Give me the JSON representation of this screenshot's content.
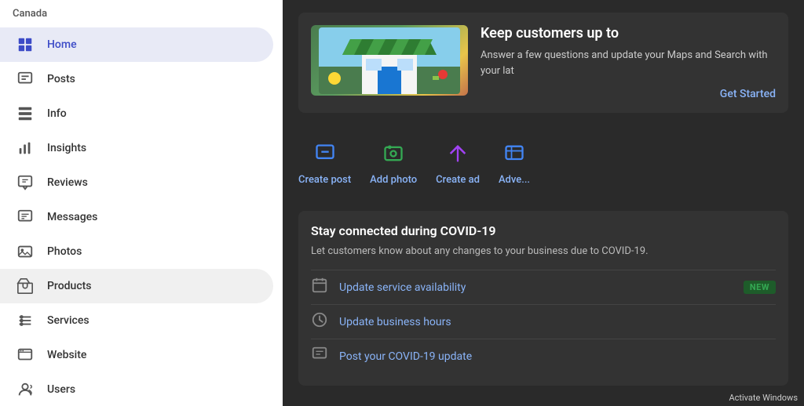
{
  "sidebar": {
    "header": "Canada",
    "items": [
      {
        "id": "home",
        "label": "Home",
        "icon": "home-icon",
        "active": true
      },
      {
        "id": "posts",
        "label": "Posts",
        "icon": "posts-icon",
        "active": false
      },
      {
        "id": "info",
        "label": "Info",
        "icon": "info-icon",
        "active": false
      },
      {
        "id": "insights",
        "label": "Insights",
        "icon": "insights-icon",
        "active": false
      },
      {
        "id": "reviews",
        "label": "Reviews",
        "icon": "reviews-icon",
        "active": false
      },
      {
        "id": "messages",
        "label": "Messages",
        "icon": "messages-icon",
        "active": false
      },
      {
        "id": "photos",
        "label": "Photos",
        "icon": "photos-icon",
        "active": false
      },
      {
        "id": "products",
        "label": "Products",
        "icon": "products-icon",
        "active": false,
        "selected": true
      },
      {
        "id": "services",
        "label": "Services",
        "icon": "services-icon",
        "active": false
      },
      {
        "id": "website",
        "label": "Website",
        "icon": "website-icon",
        "active": false
      },
      {
        "id": "users",
        "label": "Users",
        "icon": "users-icon",
        "active": false
      }
    ]
  },
  "main": {
    "banner": {
      "title": "Keep customers up to",
      "description": "Answer a few questions and update your Maps and Search with your lat",
      "cta": "Get Started"
    },
    "actions": [
      {
        "label": "Create post",
        "icon": "create-post-icon"
      },
      {
        "label": "Add photo",
        "icon": "add-photo-icon"
      },
      {
        "label": "Create ad",
        "icon": "create-ad-icon"
      },
      {
        "label": "Adve...",
        "icon": "advertise-icon"
      }
    ],
    "covid": {
      "title": "Stay connected during COVID-19",
      "description": "Let customers know about any changes to your business due to COVID-19.",
      "items": [
        {
          "label": "Update service availability",
          "badge": "NEW",
          "icon": "calendar-icon"
        },
        {
          "label": "Update business hours",
          "badge": "",
          "icon": "clock-icon"
        },
        {
          "label": "Post your COVID-19 update",
          "badge": "",
          "icon": "post-icon"
        }
      ]
    },
    "activate_windows": "Activate Windows"
  },
  "colors": {
    "active_bg": "#e8eaf6",
    "active_text": "#3c4bc7",
    "selected_bg": "#f0f0f0",
    "link": "#8ab4f8",
    "new_badge_bg": "#1e5c2a",
    "new_badge_text": "#34a853"
  }
}
